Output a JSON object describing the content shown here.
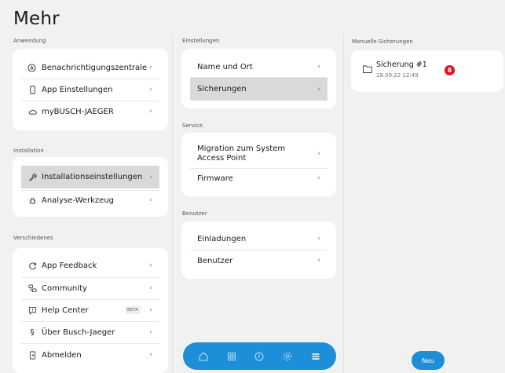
{
  "page": {
    "title": "Mehr"
  },
  "anwendung": {
    "label": "Anwendung",
    "items": [
      {
        "label": "Benachrichtigungszentrale",
        "icon": "notification-center-icon"
      },
      {
        "label": "App Einstellungen",
        "icon": "phone-icon"
      },
      {
        "label": "myBUSCH-JAEGER",
        "icon": "cloud-icon"
      }
    ]
  },
  "installation": {
    "label": "Installation",
    "items": [
      {
        "label": "Installationseinstellungen",
        "icon": "wrench-icon",
        "selected": true
      },
      {
        "label": "Analyse-Werkzeug",
        "icon": "bug-icon"
      }
    ]
  },
  "verschiedenes": {
    "label": "Verschiedenes",
    "items": [
      {
        "label": "App Feedback",
        "icon": "feedback-icon"
      },
      {
        "label": "Community",
        "icon": "community-icon"
      },
      {
        "label": "Help Center",
        "icon": "help-center-icon",
        "badge": "BETA"
      },
      {
        "label": "Über Busch-Jaeger",
        "icon": "section-icon",
        "glyph": "§"
      },
      {
        "label": "Abmelden",
        "icon": "logout-icon"
      }
    ]
  },
  "einstellungen": {
    "label": "Einstellungen",
    "items": [
      {
        "label": "Name und Ort"
      },
      {
        "label": "Sicherungen",
        "selected": true
      }
    ]
  },
  "service": {
    "label": "Service",
    "items": [
      {
        "label": "Migration zum System Access Point"
      },
      {
        "label": "Firmware"
      }
    ]
  },
  "benutzer": {
    "label": "Benutzer",
    "items": [
      {
        "label": "Einladungen"
      },
      {
        "label": "Benutzer"
      }
    ]
  },
  "backups": {
    "label": "Manuelle Sicherungen",
    "items": [
      {
        "name": "Sicherung #1",
        "date": "28.09.22 12:49",
        "icon": "folder-icon"
      }
    ],
    "new_button": "Neu",
    "badge": "8"
  },
  "navbar": {
    "items": [
      "home-icon",
      "devices-icon",
      "clock-icon",
      "settings-icon",
      "menu-icon"
    ],
    "active": "menu-icon",
    "color": "#1c8fd8"
  },
  "colors": {
    "accent": "#1c8fd8",
    "badge": "#e0101b",
    "selected": "#d9d9d9"
  }
}
